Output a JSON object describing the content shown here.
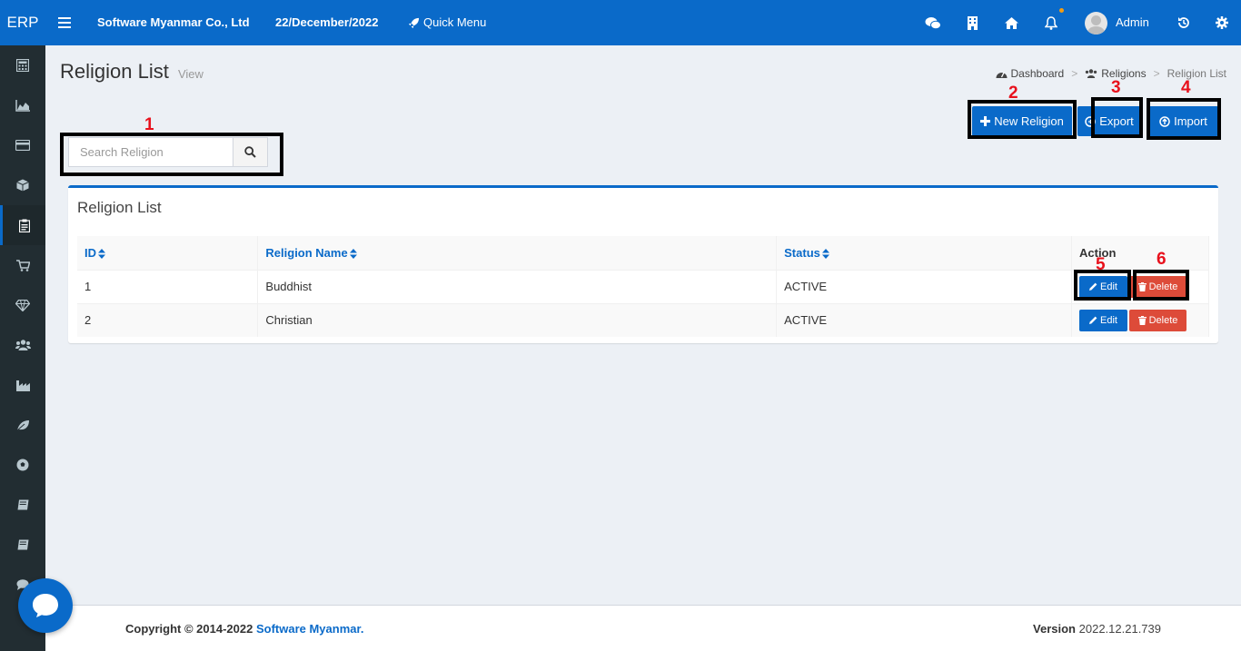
{
  "topbar": {
    "brand": "ERP",
    "company": "Software Myanmar Co., Ltd",
    "date": "22/December/2022",
    "quick_menu": "Quick Menu",
    "user": "Admin"
  },
  "page": {
    "title": "Religion List",
    "subtitle": "View"
  },
  "breadcrumb": {
    "dashboard": "Dashboard",
    "religions": "Religions",
    "current": "Religion List",
    "separator": ">"
  },
  "search": {
    "placeholder": "Search Religion"
  },
  "actions": {
    "new": "New Religion",
    "export": "Export",
    "import": "Import"
  },
  "annotations": [
    "1",
    "2",
    "3",
    "4",
    "5",
    "6"
  ],
  "panel": {
    "title": "Religion List",
    "columns": [
      "ID",
      "Religion Name",
      "Status",
      "Action"
    ],
    "rows": [
      {
        "id": "1",
        "name": "Buddhist",
        "status": "ACTIVE"
      },
      {
        "id": "2",
        "name": "Christian",
        "status": "ACTIVE"
      }
    ],
    "edit_label": "Edit",
    "delete_label": "Delete"
  },
  "footer": {
    "copyright": "Copyright © 2014-2022 ",
    "company_link": "Software Myanmar.",
    "version_label": "Version",
    "version": "2022.12.21.739"
  },
  "colors": {
    "primary": "#0a6ac9",
    "danger": "#dd4b39",
    "sidebar": "#222d32",
    "annotation_number": "#e8111c"
  }
}
